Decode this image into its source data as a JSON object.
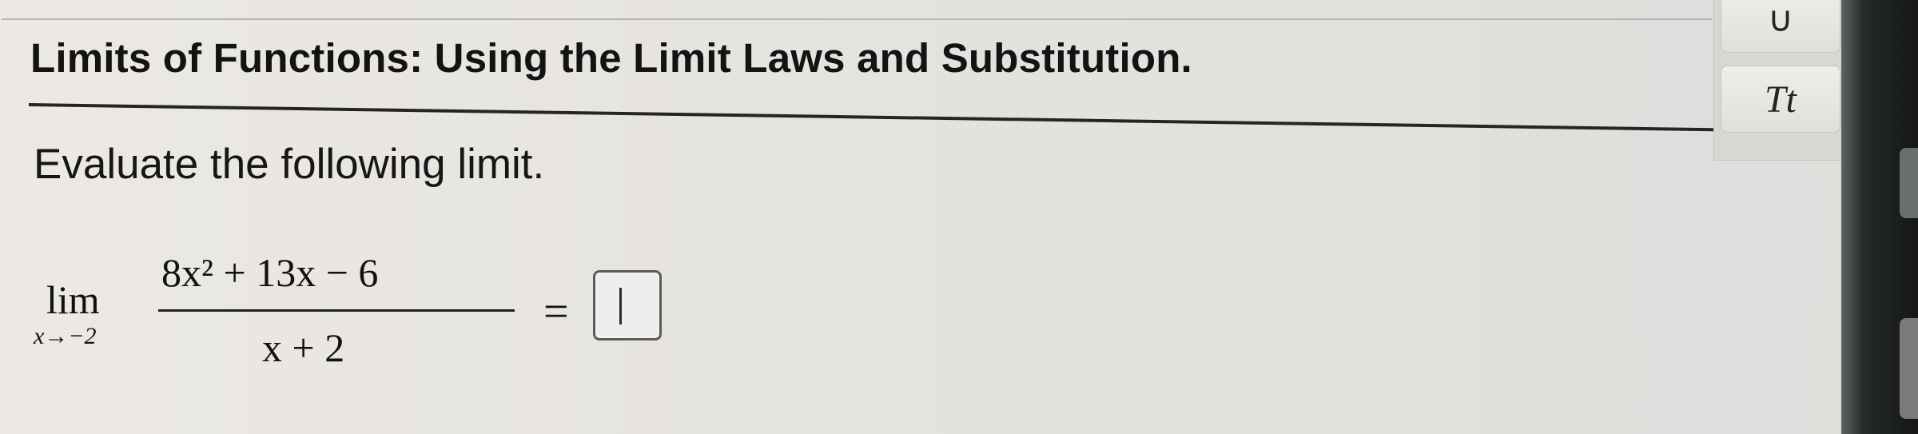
{
  "header": {
    "title": "Limits of Functions: Using the Limit Laws and Substitution."
  },
  "question": {
    "prompt": "Evaluate the following limit.",
    "limit_label": "lim",
    "approach": "x→−2",
    "numerator": "8x² + 13x − 6",
    "denominator": "x + 2",
    "equals": "=",
    "answer_value": ""
  },
  "toolbar": {
    "union_symbol": "∪",
    "text_format_label": "Tt"
  },
  "icons": {
    "union": "union-symbol-icon",
    "text_format": "text-format-icon"
  }
}
